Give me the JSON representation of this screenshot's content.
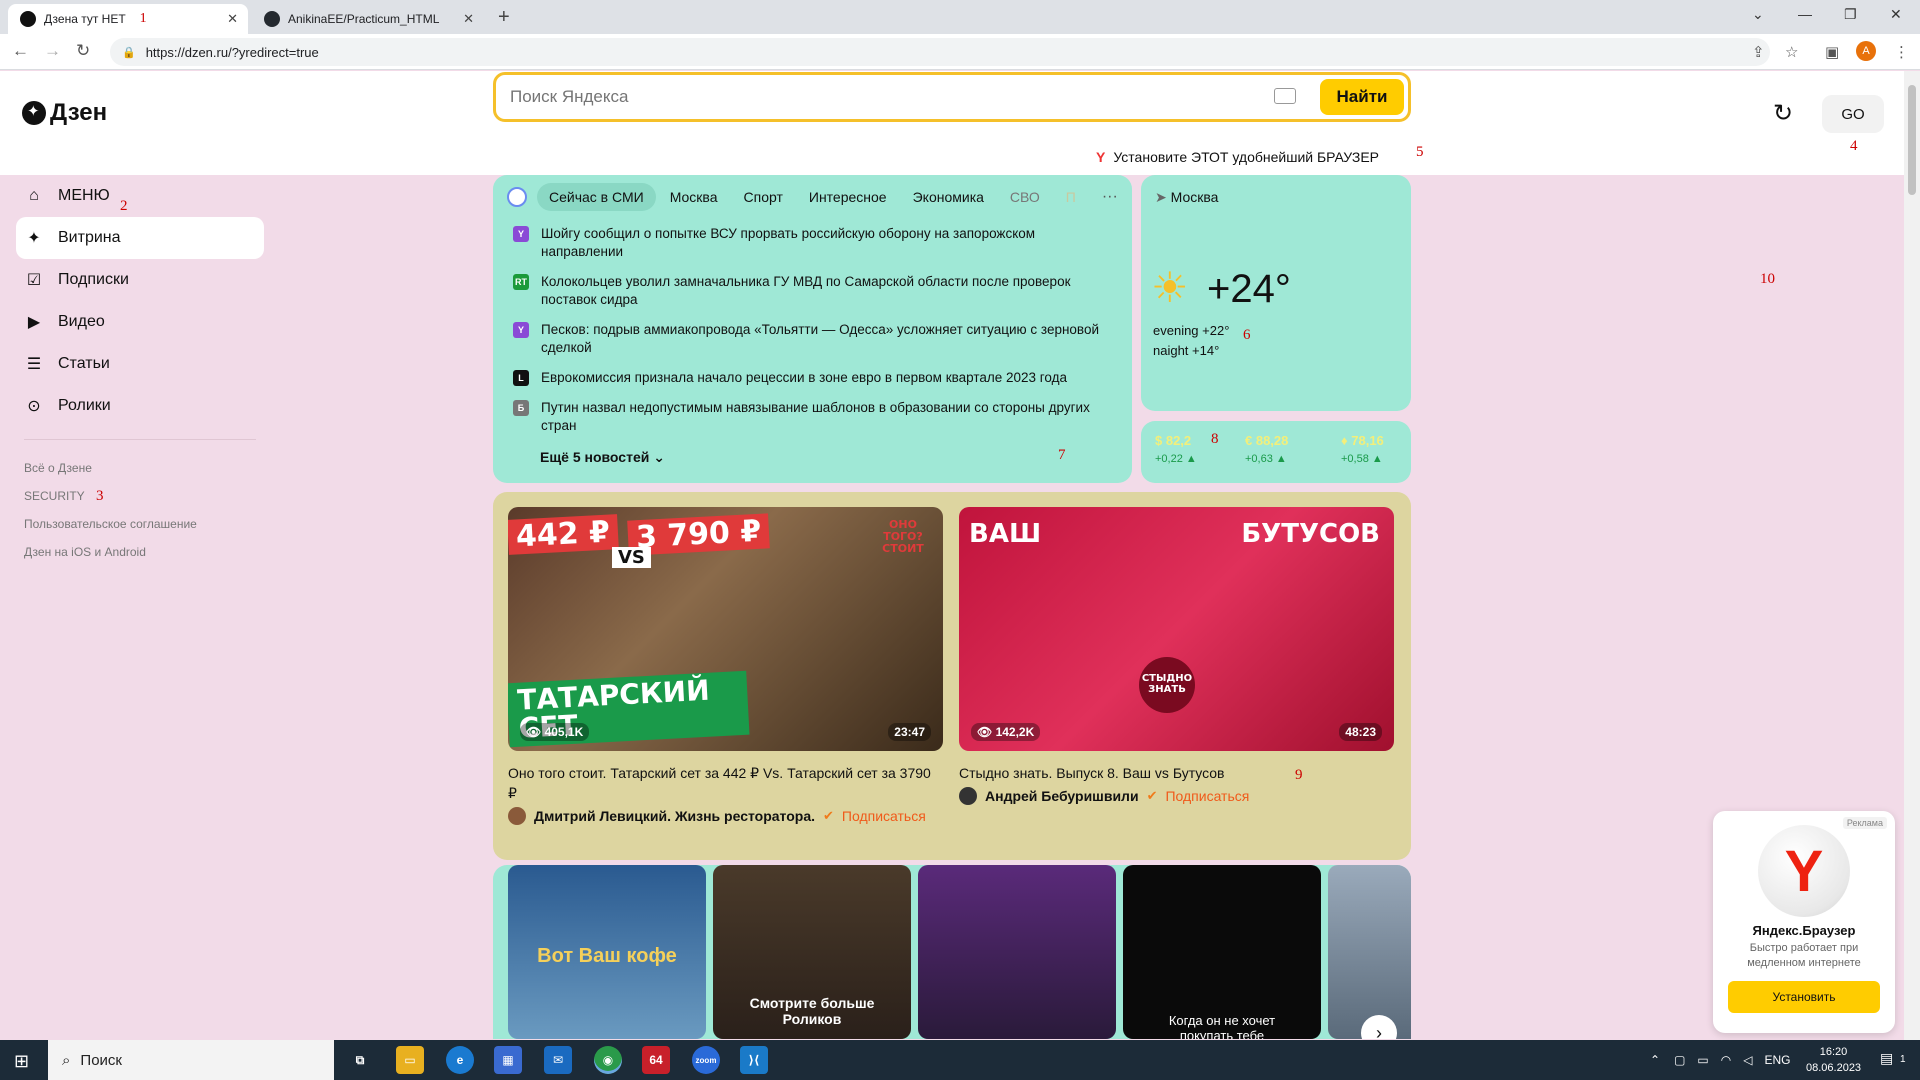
{
  "browser": {
    "tabs": [
      {
        "title": "Дзена тут НЕТ",
        "marker": "1"
      },
      {
        "title": "AnikinaEE/Practicum_HTML"
      }
    ],
    "url": "https://dzen.ru/?yredirect=true",
    "profile_initial": "A"
  },
  "header": {
    "logo": "Дзен",
    "search_placeholder": "Поиск Яндекса",
    "search_button": "Найти",
    "go_button": "GO",
    "go_marker": "4",
    "promo_text": "Установите ЭТОТ удобнейший БРАУЗЕР",
    "promo_marker": "5"
  },
  "sidebar": {
    "marker_menu": "2",
    "items": [
      {
        "label": "МЕНЮ",
        "icon": "home-icon"
      },
      {
        "label": "Витрина",
        "icon": "sparkle-icon"
      },
      {
        "label": "Подписки",
        "icon": "checkbox-icon"
      },
      {
        "label": "Видео",
        "icon": "play-icon"
      },
      {
        "label": "Статьи",
        "icon": "article-icon"
      },
      {
        "label": "Ролики",
        "icon": "shorts-icon"
      }
    ],
    "links": [
      "Всё о Дзене",
      "SECURITY",
      "Пользовательское соглашение",
      "Дзен на iOS и Android"
    ],
    "marker_security": "3"
  },
  "news": {
    "tabs": [
      "Сейчас в СМИ",
      "Москва",
      "Спорт",
      "Интересное",
      "Экономика",
      "СВО",
      "П"
    ],
    "items": [
      {
        "text": "Шойгу сообщил о попытке ВСУ прорвать российскую оборону на запорожском направлении",
        "src_color": "#8a4ad6",
        "src": "Y"
      },
      {
        "text": "Колокольцев уволил замначальника ГУ МВД по Самарской области после проверок поставок сидра",
        "src_color": "#1a9a3a",
        "src": "RT"
      },
      {
        "text": "Песков: подрыв аммиакопровода «Тольятти — Одесса» усложняет ситуацию с зерновой сделкой",
        "src_color": "#8a4ad6",
        "src": "Y"
      },
      {
        "text": "Еврокомиссия признала начало рецессии в зоне евро в первом квартале 2023 года",
        "src_color": "#111111",
        "src": "L"
      },
      {
        "text": "Путин назвал недопустимым навязывание шаблонов в образовании со стороны других стран",
        "src_color": "#777777",
        "src": "Б"
      }
    ],
    "more": "Ещё 5 новостей",
    "marker": "7"
  },
  "weather": {
    "city": "Москва",
    "temp": "+24°",
    "evening": "evening +22°",
    "night": "naight +14°",
    "marker": "6"
  },
  "rates": {
    "marker": "8",
    "items": [
      {
        "value": "$ 82,2",
        "delta": "+0,22 ▲"
      },
      {
        "value": "€ 88,28",
        "delta": "+0,63 ▲"
      },
      {
        "value": "♦ 78,16",
        "delta": "+0,58 ▲"
      }
    ]
  },
  "page_marker_10": "10",
  "feed": {
    "marker": "9",
    "cards": [
      {
        "thumb_top_left": "442 ₽",
        "thumb_top_right": "3 790 ₽",
        "thumb_vs": "VS",
        "thumb_badge": "ОНО ТОГО? СТОИТ",
        "thumb_bottom": "ТАТАРСКИЙ СЕТ",
        "views": "👁 405,1K",
        "duration": "23:47",
        "title": "Оно того стоит. Татарский сет за 442 ₽ Vs. Татарский сет за 3790 ₽",
        "author": "Дмитрий Левицкий. Жизнь ресторатора.",
        "subscribe": "Подписаться"
      },
      {
        "thumb_top_left": "ВАШ",
        "thumb_top_right": "БУТУСОВ",
        "thumb_badge": "СТЫДНО ЗНАТЬ",
        "views": "👁 142,2K",
        "duration": "48:23",
        "title": "Стыдно знать. Выпуск 8. Ваш vs Бутусов",
        "author": "Андрей Бебуришвили",
        "subscribe": "Подписаться"
      }
    ]
  },
  "shorts": [
    {
      "caption": "Вот Ваш кофе",
      "bg": "#3a7bb0"
    },
    {
      "caption": "Смотрите больше Роликов",
      "bg": "#5a4a3a"
    },
    {
      "caption": "",
      "bg": "#4a2a5a"
    },
    {
      "caption": "Когда он не хочет покупать тебе",
      "bg": "#0a0a0a"
    },
    {
      "caption": "",
      "bg": "#7a8aa0"
    }
  ],
  "ad": {
    "label": "Реклама",
    "name": "Яндекс.Браузер",
    "desc": "Быстро работает при медленном интернете",
    "button": "Установить"
  },
  "taskbar": {
    "search": "Поиск",
    "lang": "ENG",
    "time": "16:20",
    "date": "08.06.2023",
    "notif": "1"
  }
}
